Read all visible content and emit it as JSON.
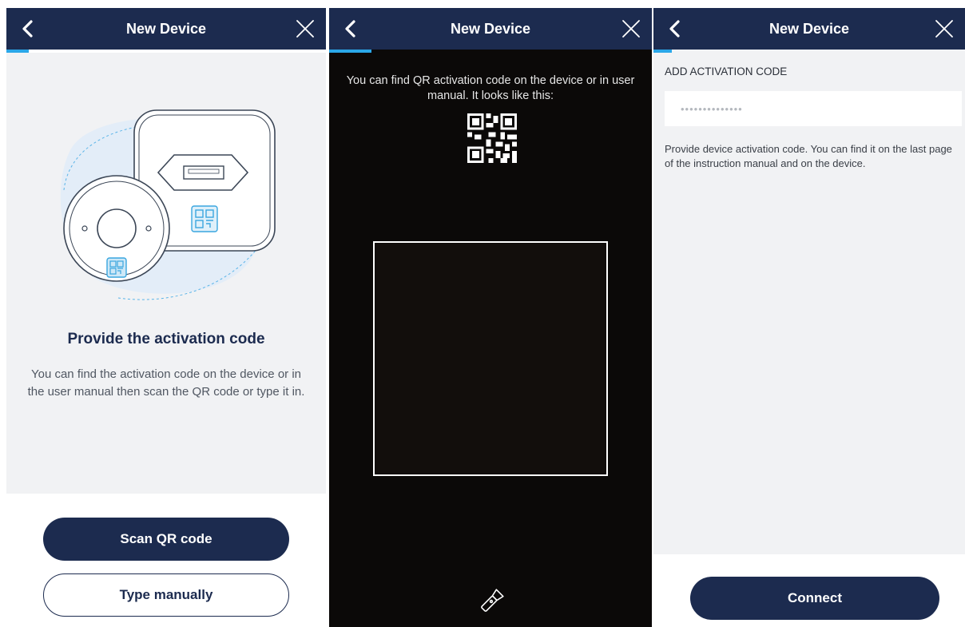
{
  "colors": {
    "header": "#1c2b4f",
    "accent": "#2aa7e8",
    "panel": "#f1f2f4",
    "camera": "#0b0908"
  },
  "icons": {
    "back": "chevron-left-icon",
    "close": "close-icon",
    "flash": "flashlight-icon"
  },
  "screens": [
    {
      "header": {
        "title": "New Device"
      },
      "progress": 0.07,
      "heading": "Provide the activation code",
      "description": "You can find the activation code on the device or in the user manual then scan the QR code or type it in.",
      "buttons": {
        "scan": "Scan QR code",
        "manual": "Type manually"
      }
    },
    {
      "header": {
        "title": "New Device"
      },
      "progress": 0.13,
      "hint": "You can find QR activation code on the device or in user manual. It looks like this:"
    },
    {
      "header": {
        "title": "New Device"
      },
      "progress": 0.06,
      "section_label": "ADD ACTIVATION CODE",
      "input_placeholder": "••••••••••••••",
      "helper": "Provide device activation code. You can find it on the last page of the instruction manual and on the device.",
      "connect_label": "Connect"
    }
  ]
}
